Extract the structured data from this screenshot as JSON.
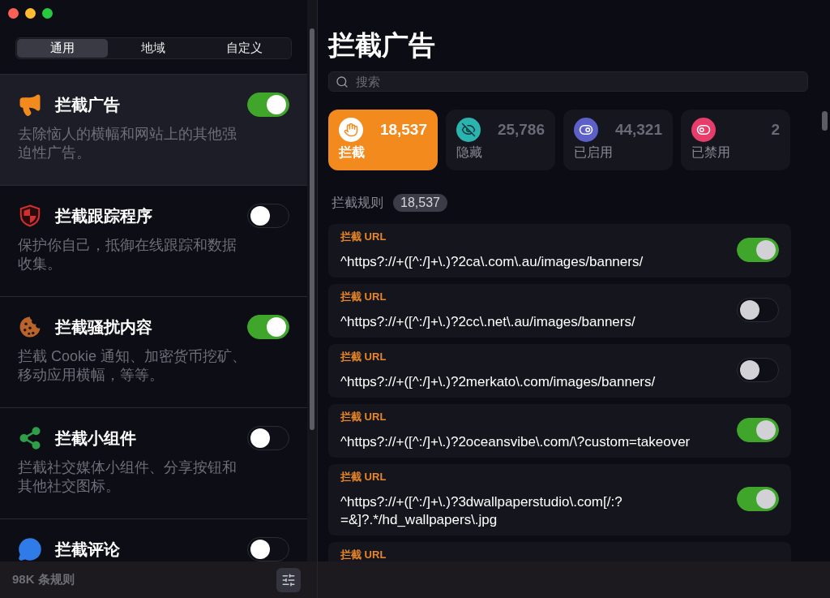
{
  "sidebar": {
    "tabs": [
      {
        "label": "通用",
        "selected": true
      },
      {
        "label": "地域",
        "selected": false
      },
      {
        "label": "自定义",
        "selected": false
      }
    ],
    "items": [
      {
        "kind": "megaphone",
        "title": "拦截广告",
        "description": "去除恼人的横幅和网站上的其他强迫性广告。",
        "enabled": true,
        "selected": true
      },
      {
        "kind": "shield",
        "title": "拦截跟踪程序",
        "description": "保护你自己，抵御在线跟踪和数据收集。",
        "enabled": false,
        "selected": false
      },
      {
        "kind": "cookie",
        "title": "拦截骚扰内容",
        "description": "拦截 Cookie 通知、加密货币挖矿、移动应用横幅，等等。",
        "enabled": true,
        "selected": false
      },
      {
        "kind": "share",
        "title": "拦截小组件",
        "description": "拦截社交媒体小组件、分享按钮和其他社交图标。",
        "enabled": false,
        "selected": false
      },
      {
        "kind": "chat",
        "title": "拦截评论",
        "enabled": false,
        "selected": false
      }
    ],
    "footer": "98K 条规则"
  },
  "main": {
    "title": "拦截广告",
    "search": {
      "placeholder": "搜索"
    },
    "stats": [
      {
        "kind": "hand",
        "count": "18,537",
        "label": "拦截",
        "color": "#ffffff",
        "selected": true
      },
      {
        "kind": "eye-off",
        "count": "25,786",
        "label": "隐藏",
        "color": "#2bb3b0",
        "selected": false
      },
      {
        "kind": "toggle-on",
        "count": "44,321",
        "label": "已启用",
        "color": "#5d60c8",
        "selected": false
      },
      {
        "kind": "toggle-off",
        "count": "2",
        "label": "已禁用",
        "color": "#e63d6a",
        "selected": false
      }
    ],
    "section": {
      "label": "拦截规则",
      "count": "18,537"
    },
    "rules": [
      {
        "type": "拦截 URL",
        "pattern": "^https?://+([^:/]+\\.)?2ca\\.com\\.au/images/banners/",
        "enabled": true
      },
      {
        "type": "拦截 URL",
        "pattern": "^https?://+([^:/]+\\.)?2cc\\.net\\.au/images/banners/",
        "enabled": false
      },
      {
        "type": "拦截 URL",
        "pattern": "^https?://+([^:/]+\\.)?2merkato\\.com/images/banners/",
        "enabled": false
      },
      {
        "type": "拦截 URL",
        "pattern": "^https?://+([^:/]+\\.)?2oceansvibe\\.com/\\?custom=takeover",
        "enabled": true
      },
      {
        "type": "拦截 URL",
        "pattern": "^https?://+([^:/]+\\.)?3dwallpaperstudio\\.com[/:?=&]?.*/hd_wallpapers\\.jpg",
        "enabled": true
      },
      {
        "type": "拦截 URL"
      }
    ]
  }
}
